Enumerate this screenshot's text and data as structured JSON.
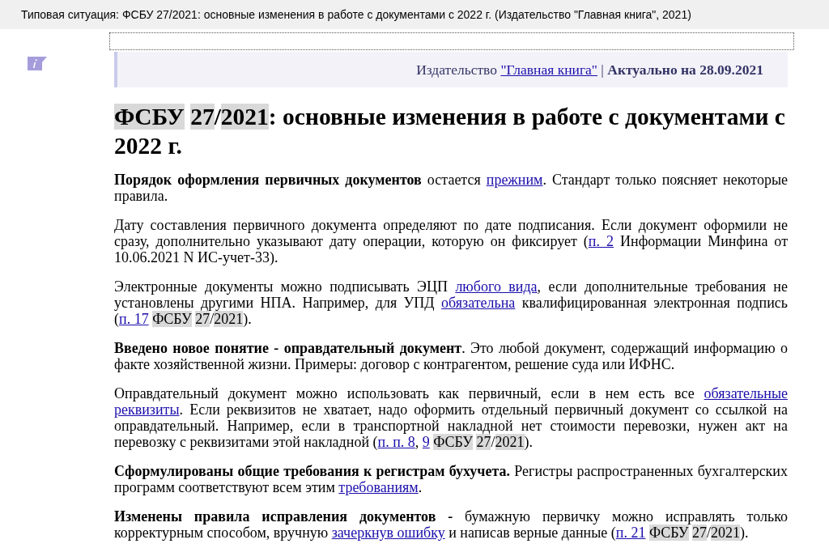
{
  "window": {
    "title": "Типовая ситуация: ФСБУ 27/2021: основные изменения в работе с документами с 2022 г. (Издательство \"Главная книга\", 2021)"
  },
  "header": {
    "segments": [
      {
        "kind": "text",
        "text": "Издательство "
      },
      {
        "kind": "link",
        "text": "\"Главная книга\""
      },
      {
        "kind": "text",
        "text": " | "
      },
      {
        "kind": "bold",
        "text": "Актуально на 28.09.2021"
      }
    ]
  },
  "heading": {
    "segments": [
      {
        "kind": "mark",
        "text": "ФСБУ",
        "space_after": true
      },
      {
        "kind": "mark",
        "text": "27"
      },
      {
        "kind": "text",
        "text": "/"
      },
      {
        "kind": "mark",
        "text": "2021"
      },
      {
        "kind": "text",
        "text": ": основные изменения в работе с документами с 2022 г."
      }
    ]
  },
  "paragraphs": [
    {
      "segments": [
        {
          "kind": "bold",
          "text": "Порядок оформления первичных документов"
        },
        {
          "kind": "text",
          "text": " остается "
        },
        {
          "kind": "link",
          "text": "прежним"
        },
        {
          "kind": "text",
          "text": ". Стандарт только поясняет некоторые правила."
        }
      ]
    },
    {
      "segments": [
        {
          "kind": "text",
          "text": "Дату составления первичного документа определяют по дате подписания. Если документ оформили не сразу, дополнительно указывают дату операции, которую он фиксирует ("
        },
        {
          "kind": "link",
          "text": "п. 2"
        },
        {
          "kind": "text",
          "text": " Информации Минфина от 10.06.2021 N ИС-учет-33)."
        }
      ]
    },
    {
      "segments": [
        {
          "kind": "text",
          "text": "Электронные документы можно подписывать ЭЦП "
        },
        {
          "kind": "link",
          "text": "любого вида"
        },
        {
          "kind": "text",
          "text": ", если дополнительные требования не установлены другими НПА. Например, для УПД "
        },
        {
          "kind": "link",
          "text": "обязательна"
        },
        {
          "kind": "text",
          "text": " квалифицированная электронная подпись ("
        },
        {
          "kind": "link",
          "text": "п. 17",
          "space_after": true
        },
        {
          "kind": "mark",
          "text": "ФСБУ",
          "space_after": true
        },
        {
          "kind": "mark",
          "text": "27"
        },
        {
          "kind": "text",
          "text": "/"
        },
        {
          "kind": "mark",
          "text": "2021"
        },
        {
          "kind": "text",
          "text": ")."
        }
      ]
    },
    {
      "segments": [
        {
          "kind": "bold",
          "text": "Введено новое понятие - оправдательный документ"
        },
        {
          "kind": "text",
          "text": ". Это любой документ, содержащий информацию о факте хозяйственной жизни. Примеры: договор с контрагентом, решение суда или ИФНС."
        }
      ]
    },
    {
      "segments": [
        {
          "kind": "text",
          "text": "Оправдательный документ можно использовать как первичный, если в нем есть все "
        },
        {
          "kind": "link",
          "text": "обязательные",
          "space_after": true
        },
        {
          "kind": "link",
          "text": "реквизиты"
        },
        {
          "kind": "text",
          "text": ". Если реквизитов не хватает, надо оформить отдельный первичный документ со ссылкой на оправдательный. Например, если в транспортной накладной нет стоимости перевозки, нужен акт на перевозку с реквизитами этой накладной ("
        },
        {
          "kind": "link",
          "text": "п. п. 8"
        },
        {
          "kind": "text",
          "text": ", "
        },
        {
          "kind": "link",
          "text": "9",
          "space_after": true
        },
        {
          "kind": "mark",
          "text": "ФСБУ",
          "space_after": true
        },
        {
          "kind": "mark",
          "text": "27"
        },
        {
          "kind": "text",
          "text": "/"
        },
        {
          "kind": "mark",
          "text": "2021"
        },
        {
          "kind": "text",
          "text": ")."
        }
      ]
    },
    {
      "segments": [
        {
          "kind": "bold",
          "text": "Сформулированы общие требования к регистрам бухучета."
        },
        {
          "kind": "text",
          "text": " Регистры распространенных бухгалтерских программ соответствуют всем этим "
        },
        {
          "kind": "link",
          "text": "требованиям"
        },
        {
          "kind": "text",
          "text": "."
        }
      ]
    },
    {
      "segments": [
        {
          "kind": "bold",
          "text": "Изменены правила исправления документов -"
        },
        {
          "kind": "text",
          "text": " бумажную первичку можно исправлять только корректурным способом, вручную "
        },
        {
          "kind": "link",
          "text": "зачеркнув ошибку"
        },
        {
          "kind": "text",
          "text": " и написав верные данные ("
        },
        {
          "kind": "link",
          "text": "п. 21",
          "space_after": true
        },
        {
          "kind": "mark",
          "text": "ФСБУ",
          "space_after": true
        },
        {
          "kind": "mark",
          "text": "27"
        },
        {
          "kind": "text",
          "text": "/"
        },
        {
          "kind": "mark",
          "text": "2021"
        },
        {
          "kind": "text",
          "text": ")."
        }
      ]
    }
  ]
}
